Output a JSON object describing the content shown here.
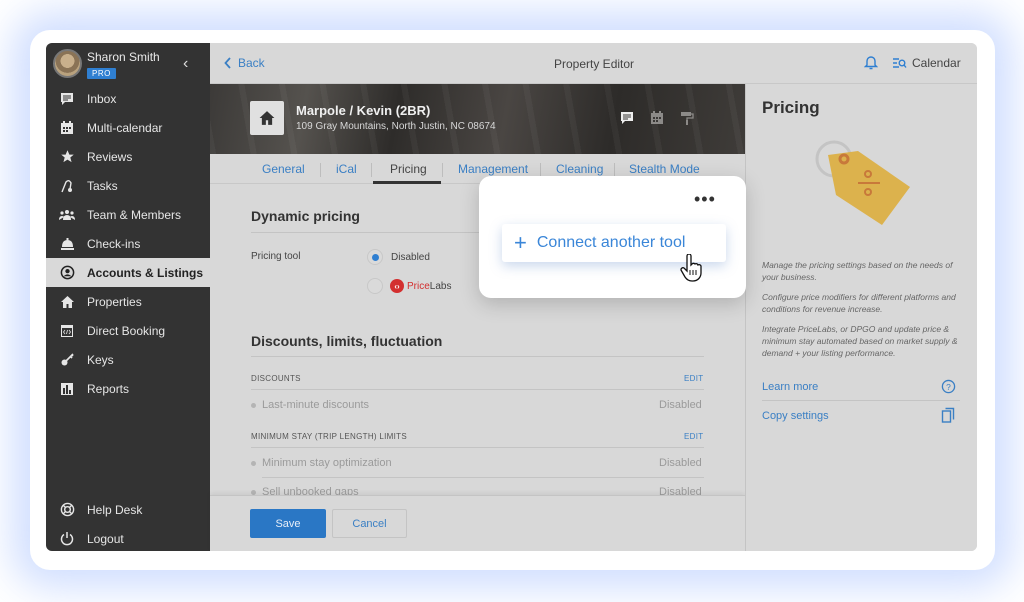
{
  "user": {
    "name": "Sharon Smith",
    "badge": "PRO"
  },
  "sidebar": {
    "items": [
      {
        "label": "Inbox",
        "icon": "inbox-icon",
        "active": false
      },
      {
        "label": "Multi-calendar",
        "icon": "calendar-icon",
        "active": false
      },
      {
        "label": "Reviews",
        "icon": "star-icon",
        "active": false
      },
      {
        "label": "Tasks",
        "icon": "tasks-icon",
        "active": false
      },
      {
        "label": "Team & Members",
        "icon": "team-icon",
        "active": false
      },
      {
        "label": "Check-ins",
        "icon": "bell-desk-icon",
        "active": false
      },
      {
        "label": "Accounts & Listings",
        "icon": "account-icon",
        "active": true
      },
      {
        "label": "Properties",
        "icon": "home-icon",
        "active": false
      },
      {
        "label": "Direct Booking",
        "icon": "code-window-icon",
        "active": false
      },
      {
        "label": "Keys",
        "icon": "key-icon",
        "active": false
      },
      {
        "label": "Reports",
        "icon": "bar-chart-icon",
        "active": false
      }
    ],
    "bottom": [
      {
        "label": "Help Desk",
        "icon": "lifebuoy-icon"
      },
      {
        "label": "Logout",
        "icon": "power-icon"
      }
    ]
  },
  "topbar": {
    "back_label": "Back",
    "title": "Property Editor",
    "calendar_label": "Calendar"
  },
  "property": {
    "name": "Marpole / Kevin (2BR)",
    "address": "109 Gray Mountains, North Justin, NC 08674"
  },
  "tabs": [
    "General",
    "iCal",
    "Pricing",
    "Management",
    "Cleaning",
    "Stealth Mode"
  ],
  "active_tab": "Pricing",
  "dynamic_pricing": {
    "title": "Dynamic pricing",
    "field_label": "Pricing tool",
    "options": [
      {
        "label": "Disabled",
        "selected": true
      },
      {
        "label_price": "Price",
        "label_labs": "Labs",
        "selected": false
      }
    ]
  },
  "discounts": {
    "title": "Discounts, limits, fluctuation",
    "groups": [
      {
        "header": "DISCOUNTS",
        "edit": "EDIT",
        "rows": [
          {
            "label": "Last-minute discounts",
            "value": "Disabled"
          }
        ]
      },
      {
        "header": "MINIMUM STAY (TRIP LENGTH) LIMITS",
        "edit": "EDIT",
        "rows": [
          {
            "label": "Minimum stay optimization",
            "value": "Disabled"
          },
          {
            "label": "Sell unbooked gaps",
            "value": "Disabled"
          }
        ]
      }
    ]
  },
  "footer": {
    "save_label": "Save",
    "cancel_label": "Cancel"
  },
  "popup": {
    "menu_label": "•••",
    "connect_label": "Connect another tool"
  },
  "right_panel": {
    "title": "Pricing",
    "paragraphs": [
      "Manage the pricing settings based on the needs of your business.",
      "Configure price modifiers for different platforms and conditions for revenue increase.",
      "Integrate PriceLabs, or DPGO and update price & minimum stay automated based on market supply & demand + your listing performance."
    ],
    "links": [
      {
        "label": "Learn more",
        "icon": "help-circle-icon"
      },
      {
        "label": "Copy settings",
        "icon": "copy-icon"
      }
    ]
  },
  "colors": {
    "accent": "#2f7fd1",
    "link": "#3a7fc4",
    "sidebar_bg": "#333333",
    "tag": "#e0b450",
    "pricelabs_red": "#d32f2f"
  }
}
